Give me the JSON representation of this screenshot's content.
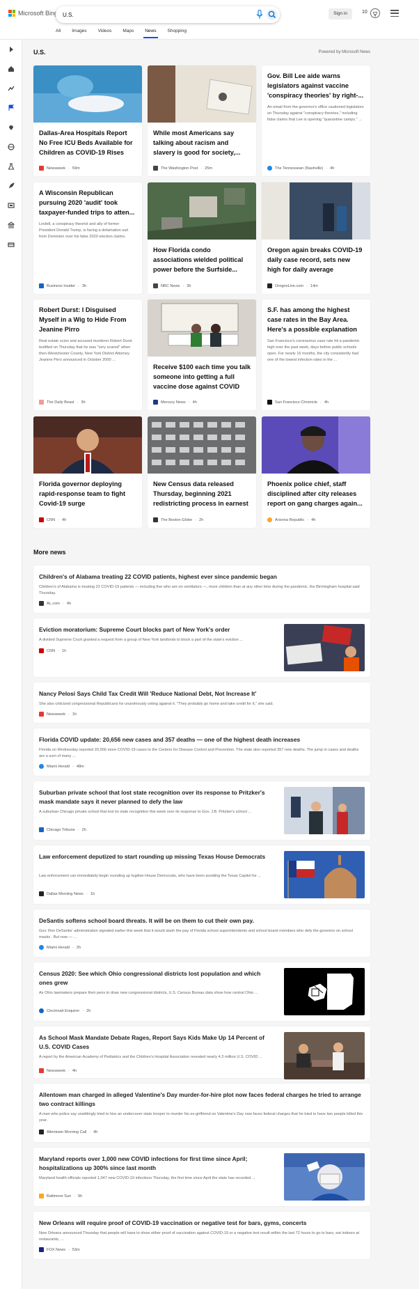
{
  "header": {
    "logo_text": "Microsoft Bing",
    "search_value": "U.S.",
    "signin_label": "Sign in",
    "points": "10"
  },
  "tabs": [
    "All",
    "Images",
    "Videos",
    "Maps",
    "News",
    "Shopping"
  ],
  "section": {
    "title": "U.S.",
    "powered_by": "Powered by Microsoft News"
  },
  "cards": [
    {
      "title": "Dallas-Area Hospitals Report No Free ICU Beds Available for Children as COVID-19 Rises",
      "source": "Newsweek",
      "time": "59m",
      "icon_color": "#e53935"
    },
    {
      "title": "While most Americans say talking about racism and slavery is good for society,...",
      "source": "The Washington Post",
      "time": "25m",
      "icon_color": "#444444"
    },
    {
      "title": "Gov. Bill Lee aide warns legislators against vaccine 'conspiracy theories' by right-...",
      "desc": "An email from the governor's office cautioned legislators on Thursday against \"conspiracy theories,\" including false claims that Lee is opening \"quarantine camps.\" ...",
      "source": "The Tennessean (Nashville)",
      "time": "4h",
      "icon_color": "#1e88e5"
    },
    {
      "title": "A Wisconsin Republican pursuing 2020 'audit' took taxpayer-funded trips to atten...",
      "desc": "Lindell, a conspiracy theorist and ally of former President Donald Trump, is facing a defamation suit from Dominion over his false 2020 election claims.",
      "source": "Business Insider",
      "time": "3h",
      "icon_color": "#1565c0"
    },
    {
      "title": "How Florida condo associations wielded political power before the Surfside...",
      "source": "NBC News",
      "time": "3h",
      "icon_color": "#444444"
    },
    {
      "title": "Oregon again breaks COVID-19 daily case record, sets new high for daily average",
      "source": "OregonLive.com",
      "time": "14m",
      "icon_color": "#222222"
    },
    {
      "title": "Robert Durst: I Disguised Myself in a Wig to Hide From Jeanine Pirro",
      "desc": "Real estate scion and accused murderer Robert Durst testified on Thursday that he was \"very scared\" when then-Westchester County, New York District Attorney Jeanine Pirro announced in October 2000 ...",
      "source": "The Daily Beast",
      "time": "3h",
      "icon_color": "#ef9a9a"
    },
    {
      "title": "Receive $100 each time you talk someone into getting a full vaccine dose against COVID",
      "source": "Mercury News",
      "time": "4h",
      "icon_color": "#1e3a8a"
    },
    {
      "title": "S.F. has among the highest case rates in the Bay Area. Here's a possible explanation",
      "desc": "San Francisco's coronavirus case rate hit a pandemic high over the past week, days before public schools open. For nearly 16 months, the city consistently had one of the lowest infection rates in the ...",
      "source": "San Francisco Chronicle",
      "time": "4h",
      "icon_color": "#111111"
    },
    {
      "title": "Florida governor deploying rapid-response team to fight Covid-19 surge",
      "source": "CNN",
      "time": "4h",
      "icon_color": "#cc0000"
    },
    {
      "title": "New Census data released Thursday, beginning 2021 redistricting process in earnest",
      "source": "The Boston Globe",
      "time": "2h",
      "icon_color": "#333333"
    },
    {
      "title": "Phoenix police chief, staff disciplined after city releases report on gang charges again...",
      "source": "Arizona Republic",
      "time": "4h",
      "icon_color": "#f9a825"
    }
  ],
  "more_news": {
    "title": "More news",
    "items": [
      {
        "title": "Children's of Alabama treating 22 COVID patients, highest ever since pandemic began",
        "desc": "Children's of Alabama is treating 22 COVID-19 patients — including five who are on ventilators —, more children than at any other time during the pandemic, the Birmingham hospital said Thursday.",
        "source": "AL.com",
        "time": "4h",
        "icon_color": "#333333"
      },
      {
        "title": "Eviction moratorium: Supreme Court blocks part of New York's order",
        "desc": "A divided Supreme Court granted a request from a group of New York landlords to block a part of the state's eviction ...",
        "source": "CNN",
        "time": "1h",
        "icon_color": "#cc0000"
      },
      {
        "title": "Nancy Pelosi Says Child Tax Credit Will 'Reduce National Debt, Not Increase It'",
        "desc": "She also criticized congressional Republicans for unanimously voting against it. \"They probably go home and take credit for it,\" she said.",
        "source": "Newsweek",
        "time": "1h",
        "icon_color": "#e53935"
      },
      {
        "title": "Florida COVID update: 20,656 new cases and 357 deaths — one of the highest death increases",
        "desc": "Florida on Wednesday reported 20,656 more COVID-19 cases to the Centers for Disease Control and Prevention. The state also reported 357 new deaths. The jump in cases and deaths are a sum of many ...",
        "source": "Miami Herald",
        "time": "48m",
        "icon_color": "#1e88e5"
      },
      {
        "title": "Suburban private school that lost state recognition over its response to Pritzker's mask mandate says it never planned to defy the law",
        "desc": "A suburban Chicago private school that lost its state recognition this week over its response to Gov. J.B. Pritzker's school ...",
        "source": "Chicago Tribune",
        "time": "2h",
        "icon_color": "#1565c0"
      },
      {
        "title": "Law enforcement deputized to start rounding up missing Texas House Democrats",
        "desc": "Law enforcement can immediately begin rounding up fugitive House Democrats, who have been avoiding the Texas Capitol for ...",
        "source": "Dallas Morning News",
        "time": "1h",
        "icon_color": "#222222"
      },
      {
        "title": "DeSantis softens school board threats. It will be on them to cut their own pay.",
        "desc": "Gov. Ron DeSantis' administration signaled earlier this week that it would slash the pay of Florida school superintendents and school board members who defy the governor on school masks . But now — ...",
        "source": "Miami Herald",
        "time": "2h",
        "icon_color": "#1e88e5"
      },
      {
        "title": "Census 2020: See which Ohio congressional districts lost population and which ones grew",
        "desc": "As Ohio lawmakers prepare their pens to draw new congressional districts, U.S. Census Bureau data show how central Ohio ...",
        "source": "Cincinnati Enquirer",
        "time": "2h",
        "icon_color": "#1565c0"
      },
      {
        "title": "As School Mask Mandate Debate Rages, Report Says Kids Make Up 14 Percent of U.S. COVID Cases",
        "desc": "A report by the American Academy of Pediatrics and the Children's Hospital Association revealed nearly 4.3 million U.S. COVID ...",
        "source": "Newsweek",
        "time": "4h",
        "icon_color": "#e53935"
      },
      {
        "title": "Allentown man charged in alleged Valentine's Day murder-for-hire plot now faces federal charges he tried to arrange two contract killings",
        "desc": "A man who police say unwittingly tried to hire an undercover state trooper to murder his ex-girlfriend on Valentine's Day now faces federal charges that he tried to have two people killed this year.",
        "source": "Allentown Morning Call",
        "time": "4h",
        "icon_color": "#222222"
      },
      {
        "title": "Maryland reports over 1,000 new COVID infections for first time since April; hospitalizations up 300% since last month",
        "desc": "Maryland health officials reported 1,047 new COVID-19 infections Thursday, the first time since April the state has recorded ...",
        "source": "Baltimore Sun",
        "time": "9h",
        "icon_color": "#f9a825"
      },
      {
        "title": "New Orleans will require proof of COVID-19 vaccination or negative test for bars, gyms, concerts",
        "desc": "New Orleans announced Thursday that people will have to show either proof of vaccination against COVID-19 or a negative test result within the last 72 hours to go to bars, eat indoors at restaurants, ...",
        "source": "FOX News",
        "time": "53m",
        "icon_color": "#1a237e"
      }
    ]
  },
  "icons": [
    "expand-icon",
    "home-icon",
    "topics-icon",
    "flag-icon",
    "location-icon",
    "globe-icon",
    "science-icon",
    "rocket-icon",
    "entertainment-icon",
    "politics-icon",
    "money-icon"
  ]
}
